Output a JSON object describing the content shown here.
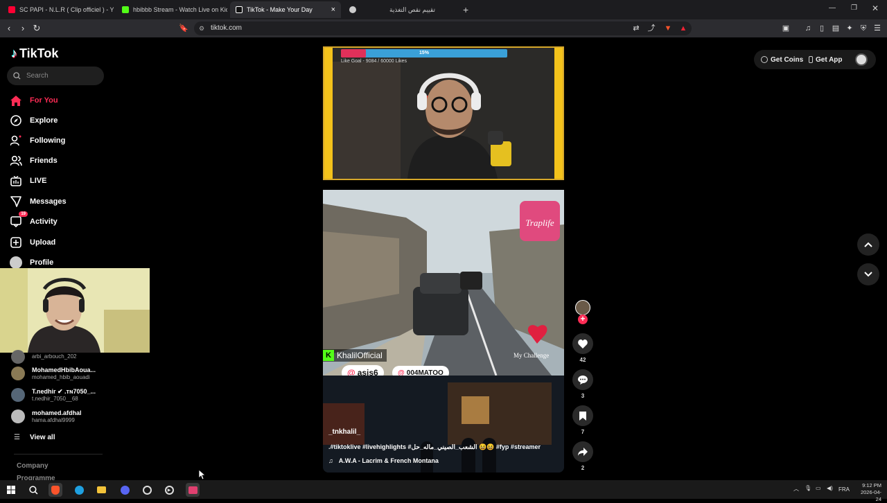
{
  "browser": {
    "tabs": [
      {
        "title": "SC PAPI - N.L.R ( Clip officiel ) - YouTu",
        "favicon_color": "#ff0033"
      },
      {
        "title": "hbibbb Stream - Watch Live on Kick",
        "favicon_color": "#53fc18"
      },
      {
        "title": "TikTok - Make Your Day",
        "favicon_color": "#ffffff"
      },
      {
        "title": "",
        "favicon_color": "#cccccc"
      },
      {
        "title": "تقييم نقص التغذية",
        "favicon_color": "#888888"
      }
    ],
    "url": "tiktok.com"
  },
  "sidebar": {
    "logo_text": "TikTok",
    "search_placeholder": "Search",
    "nav": [
      {
        "label": "For You",
        "icon": "home-icon",
        "active": true
      },
      {
        "label": "Explore",
        "icon": "compass-icon"
      },
      {
        "label": "Following",
        "icon": "user-following-icon"
      },
      {
        "label": "Friends",
        "icon": "friends-icon"
      },
      {
        "label": "LIVE",
        "icon": "live-icon"
      },
      {
        "label": "Messages",
        "icon": "messages-icon"
      },
      {
        "label": "Activity",
        "icon": "activity-icon",
        "badge": "19"
      },
      {
        "label": "Upload",
        "icon": "upload-icon"
      },
      {
        "label": "Profile",
        "icon": "profile-icon"
      }
    ],
    "following_accounts": [
      {
        "name": "",
        "handle": "arbi_arbouch_202"
      },
      {
        "name": "MohamedHbibAoua...",
        "handle": "mohamed_hbib_aouadi"
      },
      {
        "name": "T.nedhir ✔ .ᴛɴ7050_...",
        "handle": "t.nedhir_7050__68"
      },
      {
        "name": "mohamed.afdhal",
        "handle": "hama.afdhal9999"
      }
    ],
    "view_all": "View all",
    "footer": [
      "Company",
      "Programme"
    ]
  },
  "header": {
    "get_coins": "Get Coins",
    "get_app": "Get App"
  },
  "video": {
    "like_goal_percent": "15%",
    "like_goal_progress": 0.15,
    "like_goal_text": "Like Goal - 9084 / 60000 Likes",
    "channel_tag": "KhalilOfficial",
    "mentions": [
      "asis6",
      "004MATOO"
    ],
    "sticker_text": "My Challenge",
    "logo_overlay": "Traplife",
    "author": "_tnkhalil_",
    "caption": ".#tiktoklive #livehighlights #الشعب_الصيني_ماله_حل 😆😆 #fyp #streamer",
    "music": "A.W.A - Lacrim & French Montana"
  },
  "actions": {
    "likes": "42",
    "comments": "3",
    "saves": "7",
    "shares": "2"
  },
  "taskbar": {
    "language": "FRA",
    "time": "9:12 PM",
    "date": "2026-04-24"
  }
}
